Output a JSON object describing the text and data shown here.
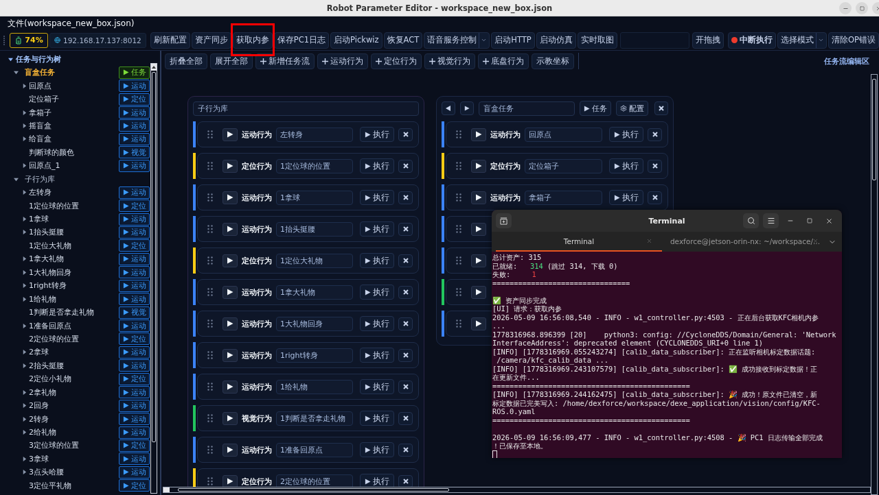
{
  "window": {
    "title": "Robot Parameter Editor - workspace_new_box.json"
  },
  "menu": {
    "file": "文件(workspace_new_box.json)"
  },
  "toolbar": {
    "battery": "74%",
    "address": "192.168.17.137:8012",
    "buttons": [
      {
        "label": "刷新配置",
        "kind": "plain",
        "highlighted": false
      },
      {
        "label": "资产同步",
        "kind": "plain",
        "highlighted": false
      },
      {
        "label": "获取内参",
        "kind": "plain",
        "highlighted": true
      },
      {
        "label": "保存PC1日志",
        "kind": "plain",
        "highlighted": false
      },
      {
        "label": "启动Pickwiz",
        "kind": "plain",
        "highlighted": false
      },
      {
        "label": "恢复ACT",
        "kind": "plain",
        "highlighted": false
      },
      {
        "label": "语音服务控制",
        "kind": "dropdown",
        "highlighted": false
      },
      {
        "label": "启动HTTP",
        "kind": "plain",
        "highlighted": false
      },
      {
        "label": "启动仿真",
        "kind": "plain",
        "highlighted": false
      },
      {
        "label": "实时取图",
        "kind": "plain",
        "highlighted": false
      }
    ],
    "right_buttons": [
      {
        "label": "开拖拽",
        "kind": "plain"
      },
      {
        "label": "中断执行",
        "kind": "stop"
      },
      {
        "label": "选择模式",
        "kind": "dropdown"
      },
      {
        "label": "清除OP错误",
        "kind": "plain"
      }
    ]
  },
  "tree": {
    "title": "任务与行为树",
    "expanded": true,
    "roots": [
      {
        "label": "盲盒任务",
        "kind": "task",
        "expanded": true,
        "badge": "任务",
        "children": [
          {
            "label": "回原点",
            "expandable": true,
            "badge": "运动"
          },
          {
            "label": "定位箱子",
            "expandable": false,
            "badge": "定位"
          },
          {
            "label": "拿箱子",
            "expandable": true,
            "badge": "运动"
          },
          {
            "label": "摇盲盒",
            "expandable": true,
            "badge": "运动"
          },
          {
            "label": "给盲盒",
            "expandable": true,
            "badge": "运动"
          },
          {
            "label": "判断球的颜色",
            "expandable": false,
            "badge": "视觉"
          },
          {
            "label": "回原点_1",
            "expandable": true,
            "badge": "运动"
          }
        ]
      },
      {
        "label": "子行为库",
        "kind": "library",
        "expanded": true,
        "children": [
          {
            "label": "左转身",
            "expandable": true,
            "badge": "运动"
          },
          {
            "label": "1定位球的位置",
            "expandable": false,
            "badge": "定位"
          },
          {
            "label": "1拿球",
            "expandable": true,
            "badge": "运动"
          },
          {
            "label": "1抬头挺腰",
            "expandable": true,
            "badge": "运动"
          },
          {
            "label": "1定位大礼物",
            "expandable": false,
            "badge": "定位"
          },
          {
            "label": "1拿大礼物",
            "expandable": true,
            "badge": "运动"
          },
          {
            "label": "1大礼物回身",
            "expandable": true,
            "badge": "运动"
          },
          {
            "label": "1right转身",
            "expandable": true,
            "badge": "运动"
          },
          {
            "label": "1给礼物",
            "expandable": true,
            "badge": "运动"
          },
          {
            "label": "1判断是否拿走礼物",
            "expandable": false,
            "badge": "视觉"
          },
          {
            "label": "1准备回原点",
            "expandable": true,
            "badge": "运动"
          },
          {
            "label": "2定位球的位置",
            "expandable": false,
            "badge": "定位"
          },
          {
            "label": "2拿球",
            "expandable": true,
            "badge": "运动"
          },
          {
            "label": "2抬头挺腰",
            "expandable": true,
            "badge": "运动"
          },
          {
            "label": "2定位小礼物",
            "expandable": false,
            "badge": "定位"
          },
          {
            "label": "2拿礼物",
            "expandable": true,
            "badge": "运动"
          },
          {
            "label": "2回身",
            "expandable": true,
            "badge": "运动"
          },
          {
            "label": "2转身",
            "expandable": true,
            "badge": "运动"
          },
          {
            "label": "2给礼物",
            "expandable": true,
            "badge": "运动"
          },
          {
            "label": "3定位球的位置",
            "expandable": false,
            "badge": "定位"
          },
          {
            "label": "3拿球",
            "expandable": true,
            "badge": "运动"
          },
          {
            "label": "3点头哈腰",
            "expandable": true,
            "badge": "运动"
          },
          {
            "label": "3定位平礼物",
            "expandable": false,
            "badge": "定位"
          }
        ]
      }
    ]
  },
  "editor": {
    "title": "任务流编辑区",
    "buttons": [
      {
        "label": "折叠全部",
        "kind": "plain"
      },
      {
        "label": "展开全部",
        "kind": "plain"
      },
      {
        "label": "新增任务流",
        "kind": "add"
      },
      {
        "label": "运动行为",
        "kind": "add"
      },
      {
        "label": "定位行为",
        "kind": "add"
      },
      {
        "label": "视觉行为",
        "kind": "add"
      },
      {
        "label": "底盘行为",
        "kind": "add"
      },
      {
        "label": "示教坐标",
        "kind": "plain"
      }
    ],
    "flows": [
      {
        "kind": "library",
        "title": "子行为库",
        "rows": [
          {
            "type_label": "运动行为",
            "name": "左转身",
            "run": "执行",
            "color": "#3b82f6"
          },
          {
            "type_label": "定位行为",
            "name": "1定位球的位置",
            "run": "执行",
            "color": "#facc15"
          },
          {
            "type_label": "运动行为",
            "name": "1拿球",
            "run": "执行",
            "color": "#3b82f6"
          },
          {
            "type_label": "运动行为",
            "name": "1抬头挺腰",
            "run": "执行",
            "color": "#3b82f6"
          },
          {
            "type_label": "定位行为",
            "name": "1定位大礼物",
            "run": "执行",
            "color": "#facc15"
          },
          {
            "type_label": "运动行为",
            "name": "1拿大礼物",
            "run": "执行",
            "color": "#3b82f6"
          },
          {
            "type_label": "运动行为",
            "name": "1大礼物回身",
            "run": "执行",
            "color": "#3b82f6"
          },
          {
            "type_label": "运动行为",
            "name": "1right转身",
            "run": "执行",
            "color": "#3b82f6"
          },
          {
            "type_label": "运动行为",
            "name": "1给礼物",
            "run": "执行",
            "color": "#3b82f6"
          },
          {
            "type_label": "视觉行为",
            "name": "1判断是否拿走礼物",
            "run": "执行",
            "color": "#22c55e"
          },
          {
            "type_label": "运动行为",
            "name": "1准备回原点",
            "run": "执行",
            "color": "#3b82f6"
          },
          {
            "type_label": "定位行为",
            "name": "2定位球的位置",
            "run": "执行",
            "color": "#facc15"
          }
        ]
      },
      {
        "kind": "task",
        "title": "盲盒任务",
        "task_button": "任务",
        "config_button": "配置",
        "rows": [
          {
            "type_label": "运动行为",
            "name": "回原点",
            "run": "执行",
            "color": "#3b82f6"
          },
          {
            "type_label": "定位行为",
            "name": "定位箱子",
            "run": "执行",
            "color": "#facc15"
          },
          {
            "type_label": "运动行为",
            "name": "拿箱子",
            "run": "执行",
            "color": "#3b82f6"
          },
          {
            "color": "#3b82f6"
          },
          {
            "color": "#3b82f6"
          },
          {
            "color": "#22c55e"
          },
          {
            "color": "#3b82f6"
          }
        ]
      }
    ]
  },
  "terminal": {
    "title": "Terminal",
    "tabs": [
      {
        "label": "Terminal",
        "selected": true
      },
      {
        "label": "dexforce@jetson-orin-nx: ~/workspace/...",
        "selected": false
      }
    ],
    "cursor": true,
    "lines": [
      {
        "text": "总计资产: 315"
      },
      {
        "parts": [
          {
            "text": "已就绪:   "
          },
          {
            "text": "314",
            "color": "#4ade80"
          },
          {
            "text": " (跳过 314, 下载 0)"
          }
        ]
      },
      {
        "parts": [
          {
            "text": "失败:     "
          },
          {
            "text": "1",
            "color": "#ef4444"
          }
        ]
      },
      {
        "text": "================================"
      },
      {
        "kind": "gap"
      },
      {
        "text": "✅ 资产同步完成"
      },
      {
        "text": "[UI] 请求：获取内参"
      },
      {
        "text": "2026-05-09 16:56:08,540 - INFO - w1_controller.py:4503 - 正在后台获取KFC相机内参"
      },
      {
        "text": "..."
      },
      {
        "text": "1778316968.896399 [20]    python3: config: //CycloneDDS/Domain/General: 'Network"
      },
      {
        "text": "InterfaceAddress': deprecated element (CYCLONEDDS_URI+0 line 1)"
      },
      {
        "text": "[INFO] [1778316969.055243274] [calib_data_subscriber]: 正在监听相机标定数据话题:"
      },
      {
        "text": " /camera/kfc_calib_data ..."
      },
      {
        "text": "[INFO] [1778316969.243107579] [calib_data_subscriber]: ✅ 成功接收到标定数据！正"
      },
      {
        "text": "在更新文件..."
      },
      {
        "text": "=============================================="
      },
      {
        "text": "[INFO] [1778316969.244162475] [calib_data_subscriber]: 🎉 成功！原文件已清空，新"
      },
      {
        "text": "标定数据已完美写入: /home/dexforce/workspace/dexe_application/vision/config/KFC-"
      },
      {
        "text": "ROS.0.yaml"
      },
      {
        "text": "=============================================="
      },
      {
        "kind": "gap"
      },
      {
        "text": "2026-05-09 16:56:09,477 - INFO - w1_controller.py:4508 - 🎉 PC1 日志传输全部完成"
      },
      {
        "text": "！已保存至本地。"
      }
    ]
  }
}
